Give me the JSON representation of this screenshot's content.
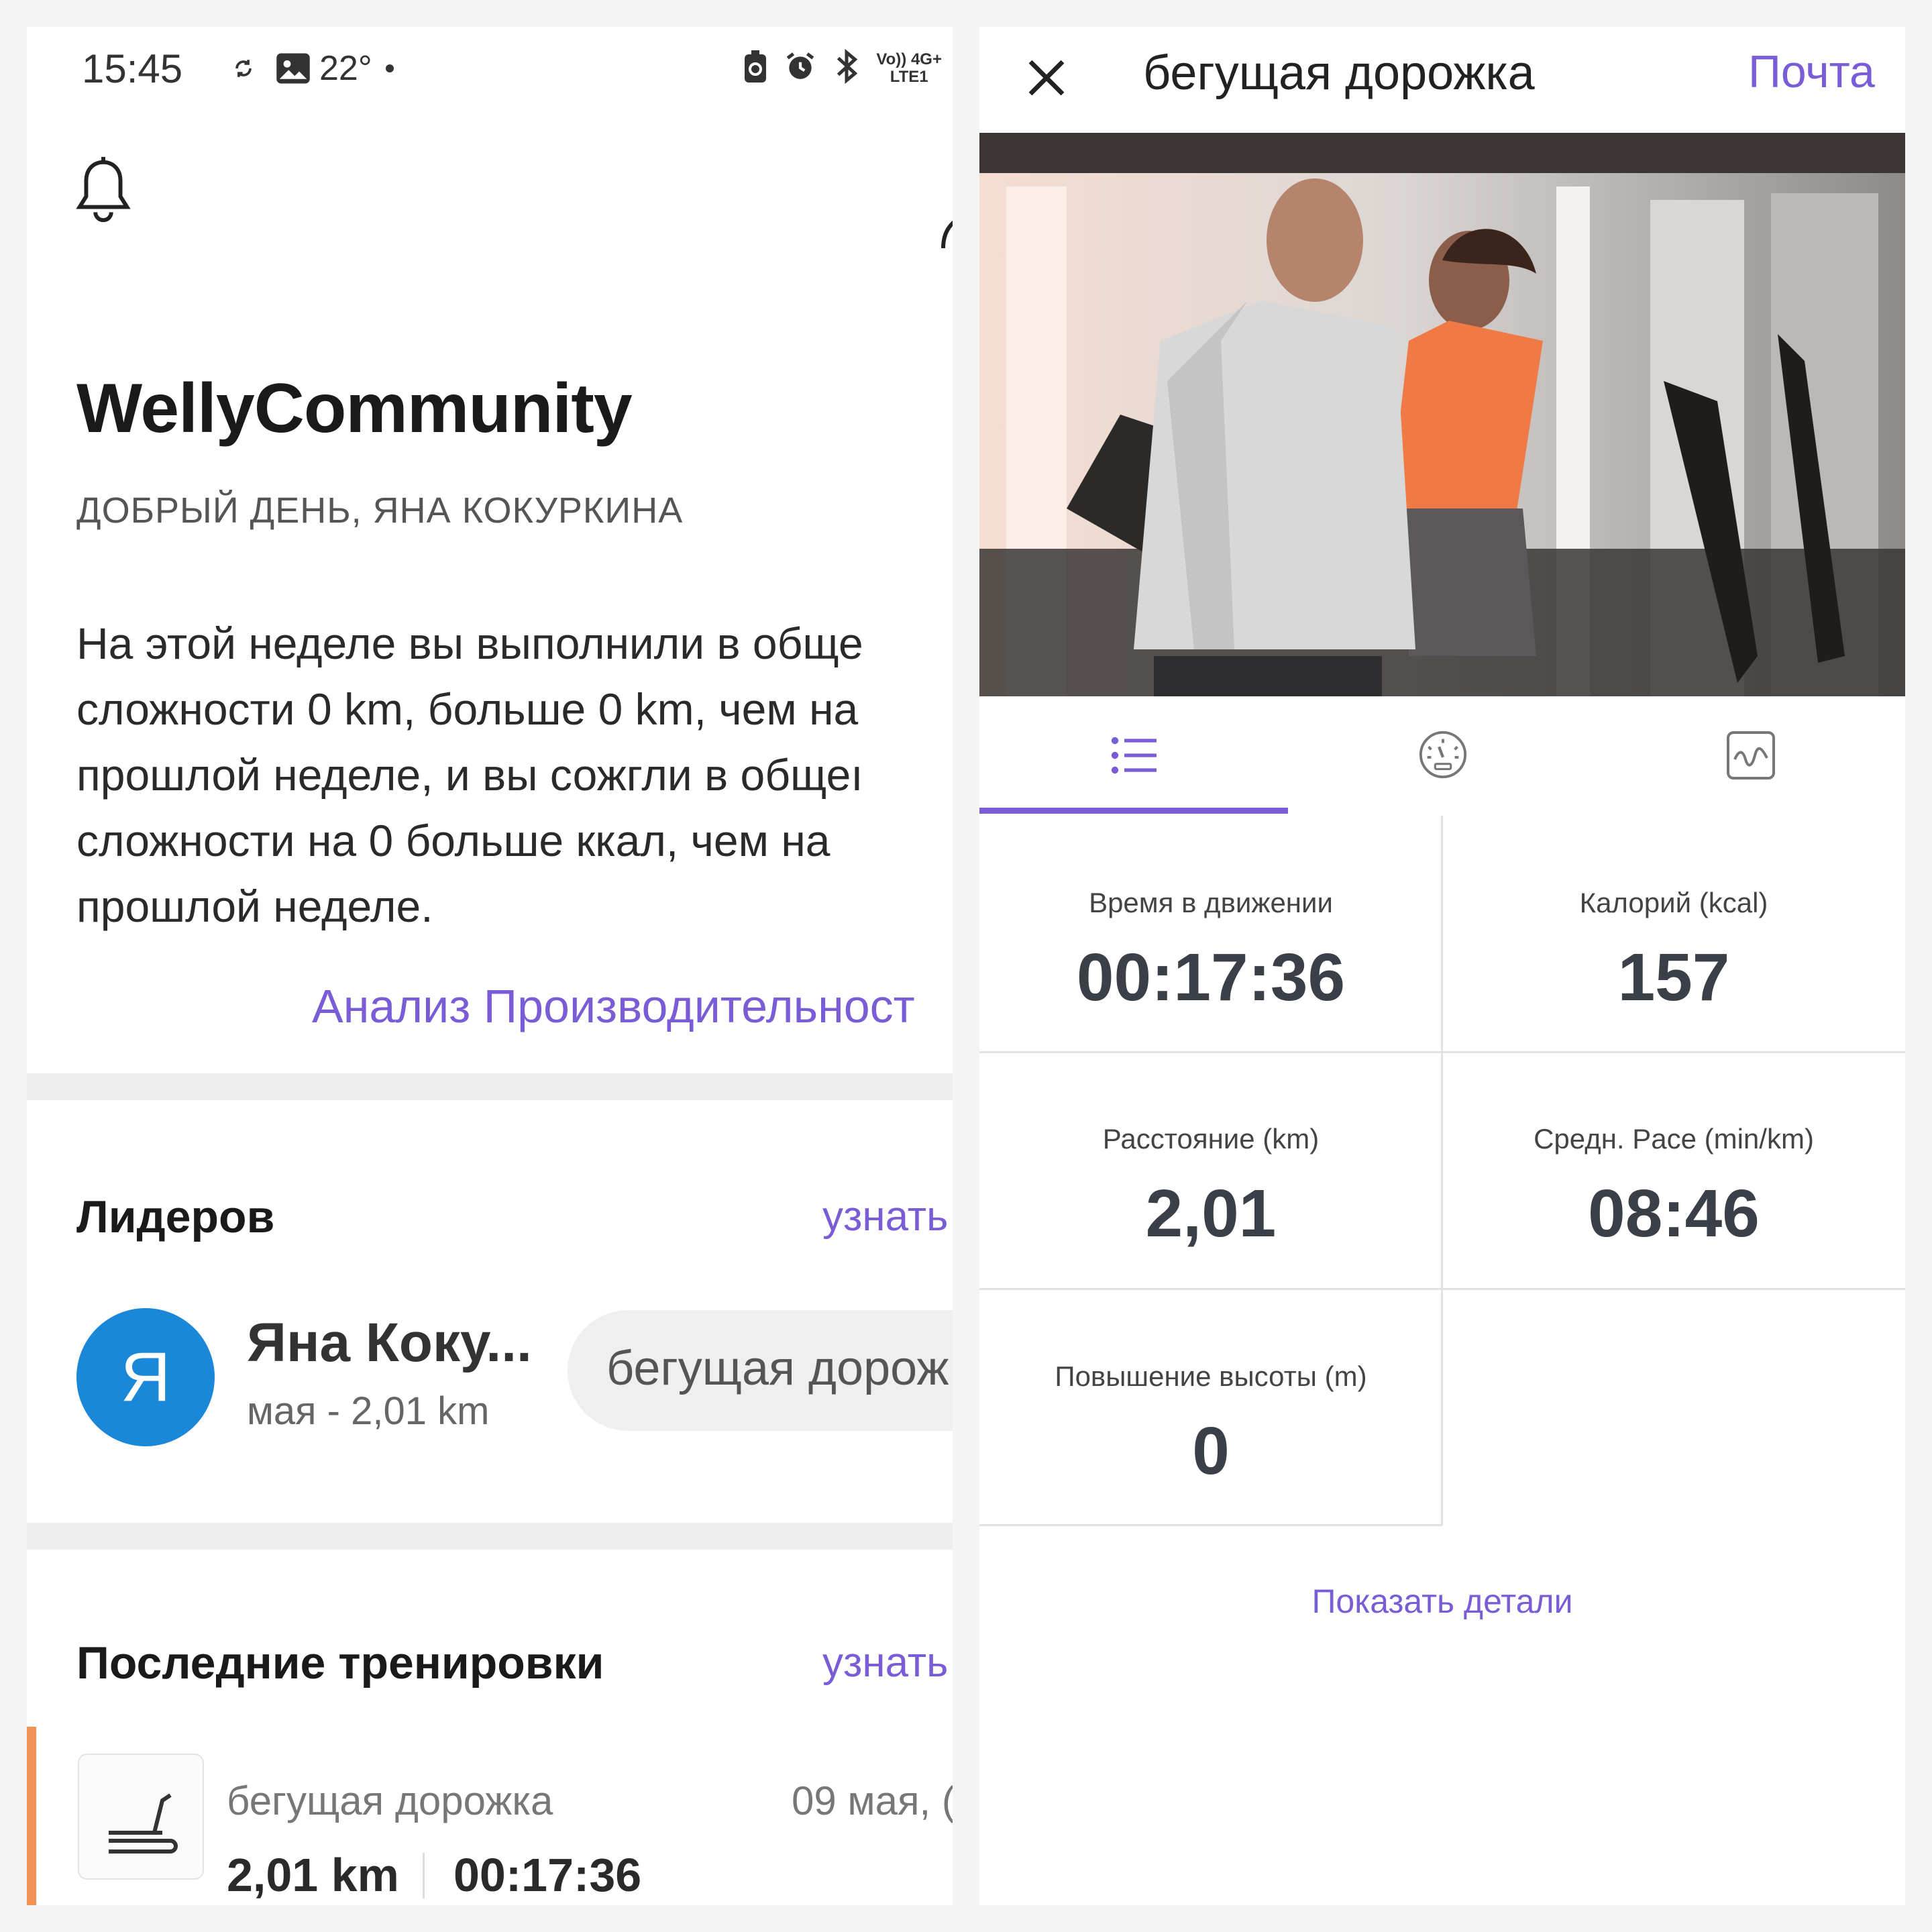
{
  "status_bar": {
    "time": "15:45",
    "temperature": "22°",
    "network_top": "Vo)) 4G+",
    "network_bottom": "LTE1"
  },
  "home": {
    "app_title": "WellyCommunity",
    "greeting": "ДОБРЫЙ ДЕНЬ, ЯНА КОКУРКИНА",
    "summary_lines": [
      "На этой неделе вы выполнили в обще",
      "сложности 0 km, больше 0 km, чем на",
      "прошлой неделе, и вы сожгли в общеı",
      "сложности на 0 больше ккал, чем на",
      "прошлой неделе."
    ],
    "analysis_link": "Анализ Производительност",
    "leaders": {
      "title": "Лидеров",
      "link": "узнать",
      "avatar_letter": "Я",
      "name": "Яна Коку...",
      "sub": "мая - 2,01 km",
      "chip": "бегущая дорож"
    },
    "recent": {
      "title": "Последние тренировки",
      "link": "узнать",
      "item": {
        "name": "бегущая дорожка",
        "date": "09 мая, (",
        "distance": "2,01 km",
        "duration": "00:17:36",
        "icon": "treadmill-icon"
      }
    }
  },
  "detail": {
    "title": "бегущая дорожка",
    "mail_link": "Почта",
    "tabs": [
      {
        "icon": "list-icon",
        "active": true
      },
      {
        "icon": "speedometer-icon",
        "active": false
      },
      {
        "icon": "chart-icon",
        "active": false
      }
    ],
    "stats": [
      {
        "label": "Время в движении",
        "value": "00:17:36"
      },
      {
        "label": "Калорий (kcal)",
        "value": "157"
      },
      {
        "label": "Расстояние (km)",
        "value": "2,01"
      },
      {
        "label": "Средн. Pace (min/km)",
        "value": "08:46"
      },
      {
        "label": "Повышение высоты (m)",
        "value": "0"
      }
    ],
    "details_link": "Показать детали"
  },
  "colors": {
    "accent": "#7a5cd6",
    "avatar": "#1a87d8",
    "workout_bar": "#f39256"
  }
}
